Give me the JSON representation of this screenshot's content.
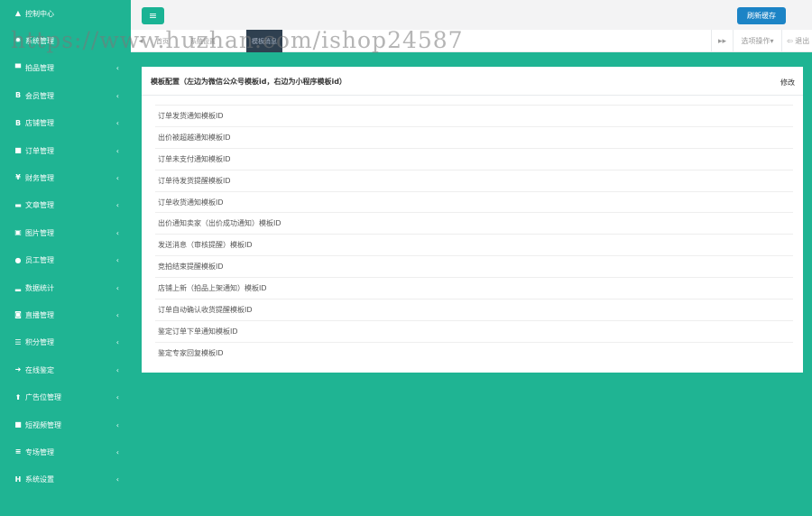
{
  "sidebar": {
    "items": [
      {
        "icon": "warning-icon",
        "glyph": "▲",
        "label": "控制中心",
        "has_chevron": false
      },
      {
        "icon": "gear-icon",
        "glyph": "✹",
        "label": "系统管理",
        "has_chevron": false
      },
      {
        "icon": "cart-icon",
        "glyph": "▀",
        "label": "拍品管理",
        "has_chevron": true
      },
      {
        "icon": "bold-b-icon",
        "glyph": "B",
        "label": "会员管理",
        "has_chevron": true
      },
      {
        "icon": "bold-b-icon",
        "glyph": "B",
        "label": "店铺管理",
        "has_chevron": true
      },
      {
        "icon": "book-icon",
        "glyph": "■",
        "label": "订单管理",
        "has_chevron": true
      },
      {
        "icon": "yen-icon",
        "glyph": "¥",
        "label": "财务管理",
        "has_chevron": true
      },
      {
        "icon": "folder-icon",
        "glyph": "▬",
        "label": "文章管理",
        "has_chevron": true
      },
      {
        "icon": "image-icon",
        "glyph": "▣",
        "label": "图片管理",
        "has_chevron": true
      },
      {
        "icon": "user-icon",
        "glyph": "●",
        "label": "员工管理",
        "has_chevron": true
      },
      {
        "icon": "signal-icon",
        "glyph": "▂",
        "label": "数据统计",
        "has_chevron": true
      },
      {
        "icon": "camera-icon",
        "glyph": "◙",
        "label": "直播管理",
        "has_chevron": true
      },
      {
        "icon": "list-icon",
        "glyph": "☰",
        "label": "积分管理",
        "has_chevron": true
      },
      {
        "icon": "arrow-right-icon",
        "glyph": "➜",
        "label": "在线鉴定",
        "has_chevron": true
      },
      {
        "icon": "arrow-up-icon",
        "glyph": "⬆",
        "label": "广告位管理",
        "has_chevron": true
      },
      {
        "icon": "video-icon",
        "glyph": "■",
        "label": "短视频管理",
        "has_chevron": true
      },
      {
        "icon": "menu-icon",
        "glyph": "≡",
        "label": "专场管理",
        "has_chevron": true
      },
      {
        "icon": "h-icon",
        "glyph": "H",
        "label": "系统设置",
        "has_chevron": true
      }
    ],
    "chevron": "‹"
  },
  "header": {
    "menu_toggle_glyph": "≡",
    "refresh_cache_label": "刷新缓存"
  },
  "tabs": {
    "prev_glyph": "◂",
    "items": [
      "首页",
      "系统设置",
      "模板消息"
    ],
    "active_index": 2,
    "next_glyph": "▸▸",
    "options_label": "选项操作▾",
    "exit_label": "⇦ 退出"
  },
  "watermark": "https://www.huzhan.com/ishop24587",
  "panel": {
    "title": "模板配置（左边为微信公众号模板id，右边为小程序模板id）",
    "edit_label": "修改",
    "rows": [
      "订单发货通知模板ID",
      "出价被超越通知模板ID",
      "订单未支付通知模板ID",
      "订单待发货提醒模板ID",
      "订单收货通知模板ID",
      "出价通知卖家（出价成功通知）模板ID",
      "发送消息（审核提醒）模板ID",
      "竞拍结束提醒模板ID",
      "店铺上新（拍品上架通知）模板ID",
      "订单自动确认收货提醒模板ID",
      "鉴定订单下单通知模板ID",
      "鉴定专家回复模板ID"
    ]
  },
  "colors": {
    "brand_green": "#1fb493",
    "primary_blue": "#1c84c6",
    "active_tab": "#2f4050"
  }
}
